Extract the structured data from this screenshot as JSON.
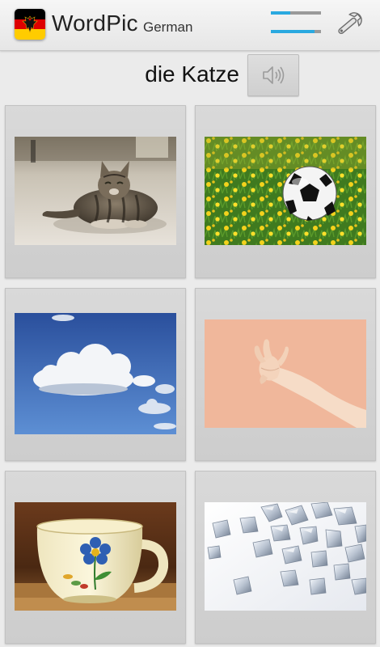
{
  "header": {
    "flag_icon": "germany-flag-icon",
    "app_title": "WordPic",
    "language": "German",
    "level_icon": "level-bars-icon",
    "settings_icon": "wrench-icon"
  },
  "prompt": {
    "word": "die Katze",
    "audio_icon": "speaker-icon"
  },
  "tiles": [
    {
      "image": "cat"
    },
    {
      "image": "soccer-ball-on-grass"
    },
    {
      "image": "cloud"
    },
    {
      "image": "hand"
    },
    {
      "image": "cup"
    },
    {
      "image": "ice-cubes"
    }
  ],
  "colors": {
    "flag_black": "#000000",
    "flag_red": "#dd0000",
    "flag_gold": "#ffcc00",
    "level_accent": "#2aa9e0"
  }
}
